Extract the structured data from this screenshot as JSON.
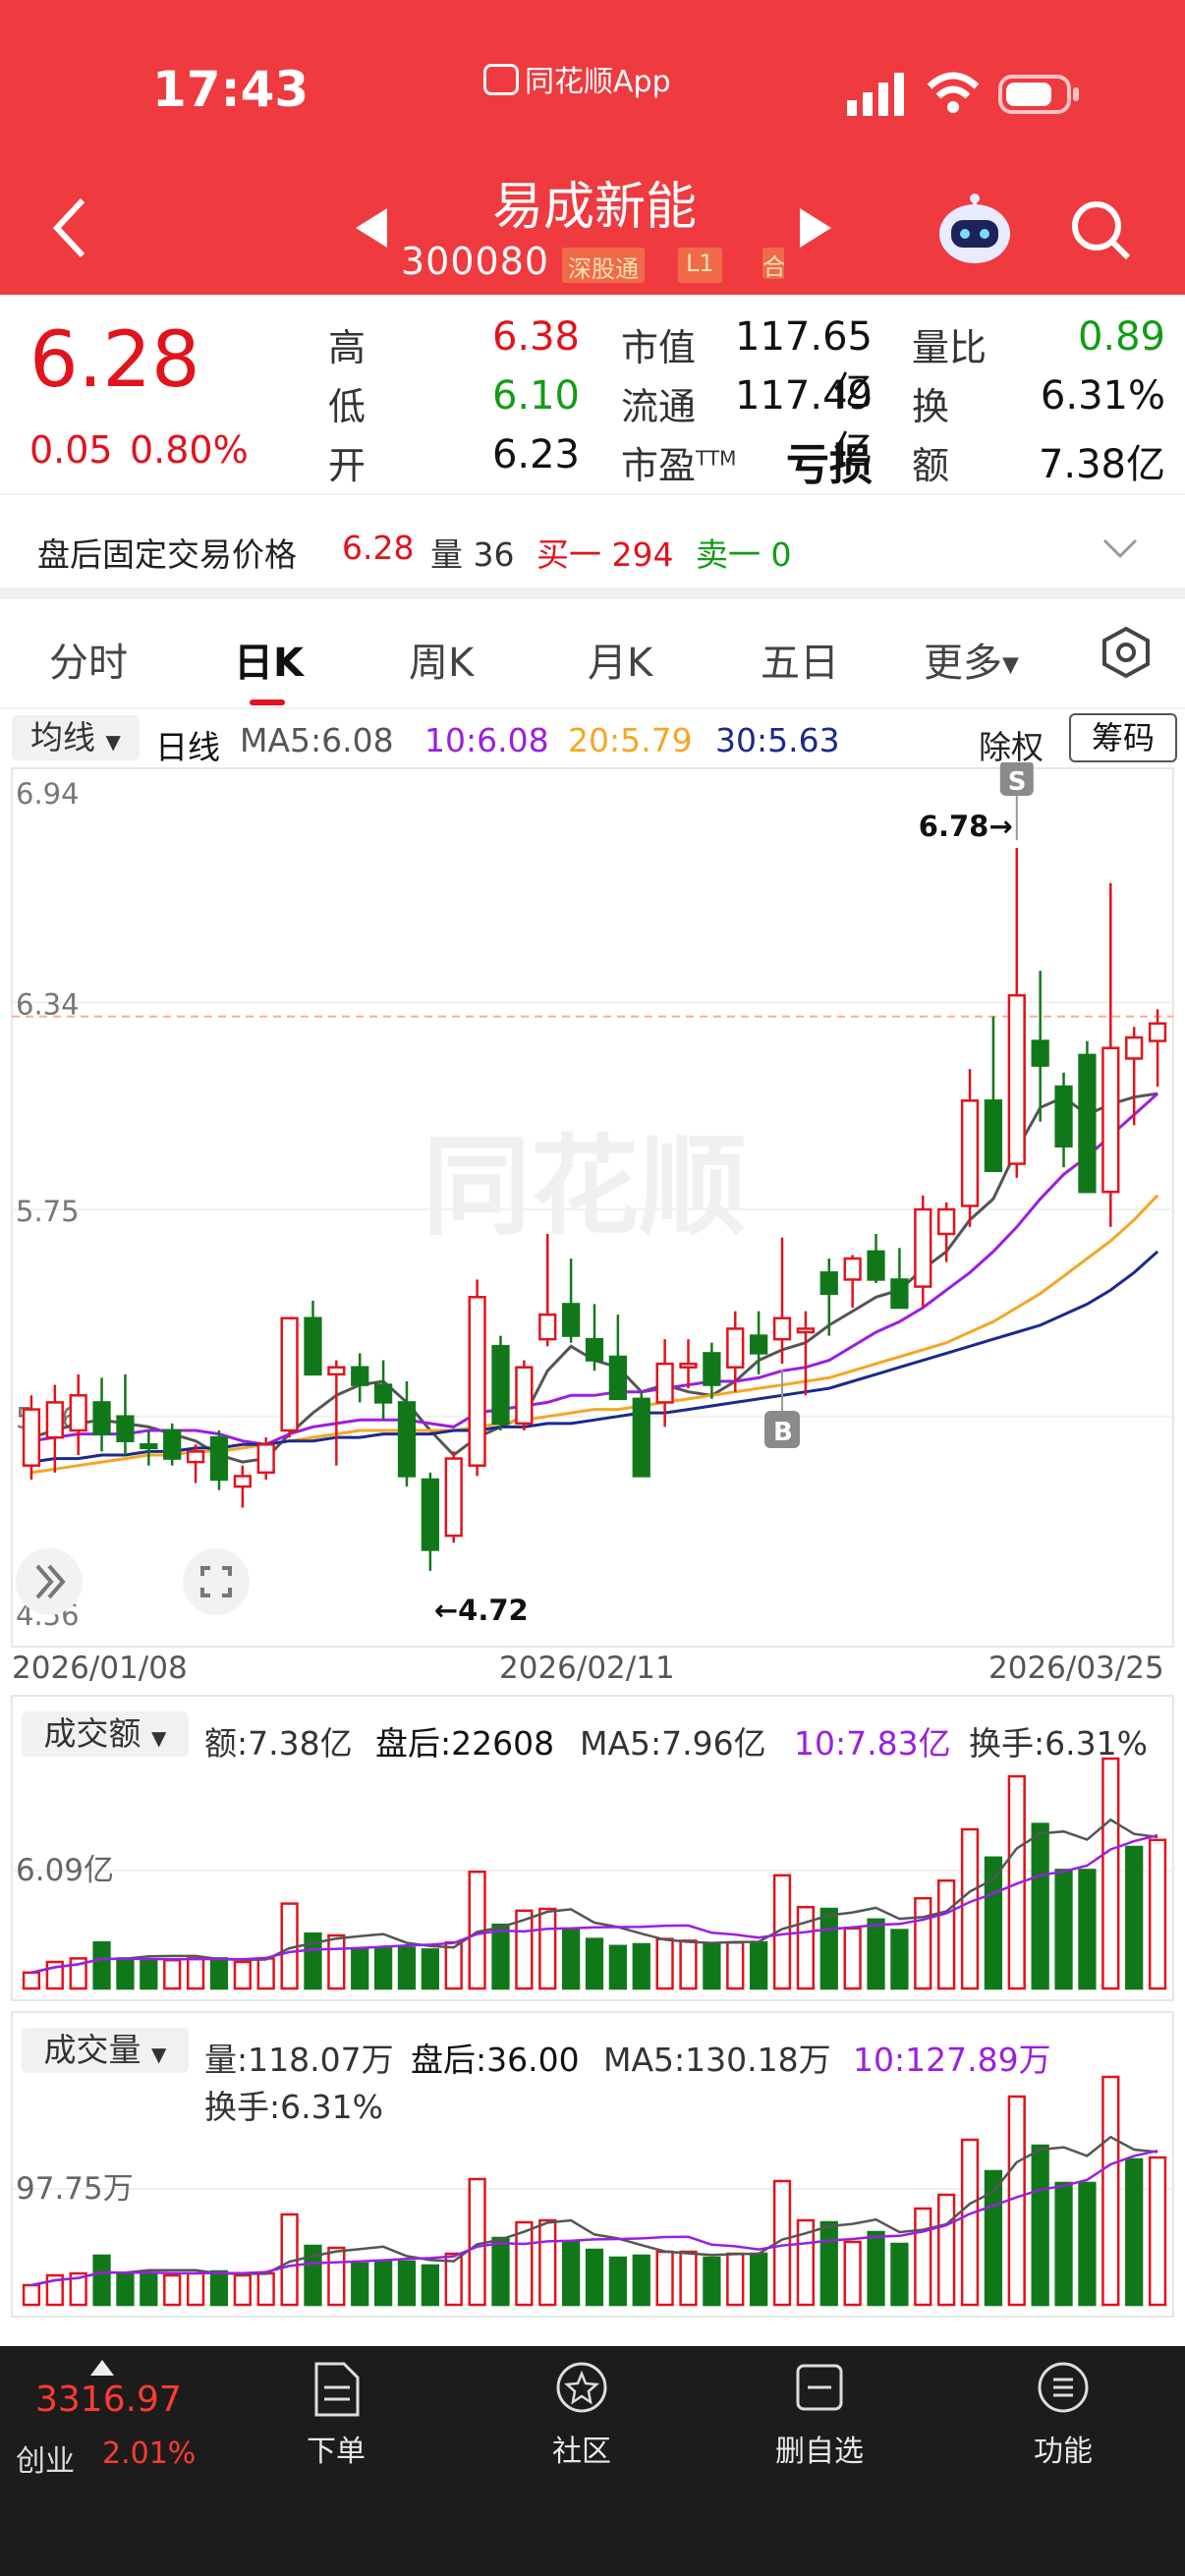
{
  "status": {
    "time": "17:43",
    "app": "同花顺App"
  },
  "header": {
    "stock_name": "易成新能",
    "code": "300080",
    "tag1": "深股通",
    "tag2": "L1",
    "tag3": "合"
  },
  "quote": {
    "price": "6.28",
    "change": "0.05",
    "change_pct": "0.80%",
    "rows": [
      [
        {
          "l": "高",
          "v": "6.38"
        },
        {
          "l": "市值",
          "v": "117.65亿"
        },
        {
          "l": "量比",
          "v": "0.89"
        }
      ],
      [
        {
          "l": "低",
          "v": "6.10"
        },
        {
          "l": "流通",
          "v": "117.49亿"
        },
        {
          "l": "换",
          "v": "6.31%"
        }
      ],
      [
        {
          "l": "开",
          "v": "6.23"
        },
        {
          "l": "市盈",
          "v": "亏损"
        },
        {
          "l": "额",
          "v": "7.38亿"
        }
      ]
    ],
    "ttm": "TTM"
  },
  "after_hours": {
    "label": "盘后固定交易价格",
    "price": "6.28",
    "vol_label": "量 36",
    "buy": "买一 294",
    "sell": "卖一 0"
  },
  "tabs": [
    "分时",
    "日K",
    "周K",
    "月K",
    "五日",
    "更多"
  ],
  "active_tab": "日K",
  "ma_legend": {
    "select": "均线",
    "period": "日线",
    "ma5": "MA5:6.08",
    "ma10": "10:6.08",
    "ma20": "20:5.79",
    "ma30": "30:5.63",
    "fq": "除权",
    "chips": "筹码"
  },
  "colors": {
    "up": "#e1131c",
    "down": "#11781a",
    "ma5": "#555555",
    "ma10": "#9b1fe0",
    "ma20": "#f5a623",
    "ma30": "#1a2a8c",
    "brand": "#ef3a3f"
  },
  "kline": {
    "y_labels": [
      "6.94",
      "6.34",
      "5.75",
      "5.16",
      "4.56"
    ],
    "x_labels": [
      "2026/01/08",
      "2026/02/11",
      "2026/03/25"
    ],
    "high_marker": "6.78→",
    "low_marker": "←4.72",
    "marker_s": "S",
    "marker_b": "B",
    "watermark": "同花顺"
  },
  "chart_data": [
    {
      "type": "candlestick",
      "ylim": [
        4.56,
        6.94
      ],
      "x_ticks": [
        "2026/01/08",
        "2026/02/11",
        "2026/03/25"
      ],
      "candles": [
        {
          "o": 5.02,
          "h": 5.22,
          "l": 4.98,
          "c": 5.18
        },
        {
          "o": 5.1,
          "h": 5.25,
          "l": 5.0,
          "c": 5.2
        },
        {
          "o": 5.12,
          "h": 5.28,
          "l": 5.05,
          "c": 5.22
        },
        {
          "o": 5.2,
          "h": 5.27,
          "l": 5.06,
          "c": 5.11
        },
        {
          "o": 5.16,
          "h": 5.28,
          "l": 5.05,
          "c": 5.09
        },
        {
          "o": 5.08,
          "h": 5.12,
          "l": 5.02,
          "c": 5.07
        },
        {
          "o": 5.12,
          "h": 5.14,
          "l": 5.02,
          "c": 5.04
        },
        {
          "o": 5.03,
          "h": 5.08,
          "l": 4.97,
          "c": 5.06
        },
        {
          "o": 5.1,
          "h": 5.12,
          "l": 4.95,
          "c": 4.98
        },
        {
          "o": 4.96,
          "h": 5.02,
          "l": 4.9,
          "c": 4.99
        },
        {
          "o": 5.0,
          "h": 5.1,
          "l": 4.98,
          "c": 5.08
        },
        {
          "o": 5.12,
          "h": 5.44,
          "l": 5.1,
          "c": 5.44
        },
        {
          "o": 5.44,
          "h": 5.49,
          "l": 5.28,
          "c": 5.28
        },
        {
          "o": 5.28,
          "h": 5.32,
          "l": 5.02,
          "c": 5.3
        },
        {
          "o": 5.3,
          "h": 5.34,
          "l": 5.2,
          "c": 5.25
        },
        {
          "o": 5.25,
          "h": 5.32,
          "l": 5.15,
          "c": 5.2
        },
        {
          "o": 5.2,
          "h": 5.26,
          "l": 4.96,
          "c": 4.99
        },
        {
          "o": 4.98,
          "h": 5.0,
          "l": 4.72,
          "c": 4.78
        },
        {
          "o": 4.82,
          "h": 5.06,
          "l": 4.8,
          "c": 5.04
        },
        {
          "o": 5.02,
          "h": 5.55,
          "l": 4.99,
          "c": 5.5
        },
        {
          "o": 5.36,
          "h": 5.39,
          "l": 5.12,
          "c": 5.14
        },
        {
          "o": 5.14,
          "h": 5.32,
          "l": 5.12,
          "c": 5.3
        },
        {
          "o": 5.38,
          "h": 5.68,
          "l": 5.36,
          "c": 5.45
        },
        {
          "o": 5.48,
          "h": 5.61,
          "l": 5.37,
          "c": 5.39
        },
        {
          "o": 5.38,
          "h": 5.48,
          "l": 5.29,
          "c": 5.32
        },
        {
          "o": 5.33,
          "h": 5.45,
          "l": 5.25,
          "c": 5.21
        },
        {
          "o": 5.21,
          "h": 5.23,
          "l": 4.99,
          "c": 4.99
        },
        {
          "o": 5.2,
          "h": 5.38,
          "l": 5.13,
          "c": 5.31
        },
        {
          "o": 5.3,
          "h": 5.38,
          "l": 5.24,
          "c": 5.31
        },
        {
          "o": 5.34,
          "h": 5.37,
          "l": 5.21,
          "c": 5.25
        },
        {
          "o": 5.3,
          "h": 5.46,
          "l": 5.23,
          "c": 5.41
        },
        {
          "o": 5.39,
          "h": 5.46,
          "l": 5.28,
          "c": 5.34
        },
        {
          "o": 5.38,
          "h": 5.67,
          "l": 5.31,
          "c": 5.44
        },
        {
          "o": 5.4,
          "h": 5.46,
          "l": 5.22,
          "c": 5.41
        },
        {
          "o": 5.57,
          "h": 5.61,
          "l": 5.39,
          "c": 5.51
        },
        {
          "o": 5.55,
          "h": 5.62,
          "l": 5.47,
          "c": 5.61
        },
        {
          "o": 5.63,
          "h": 5.68,
          "l": 5.54,
          "c": 5.55
        },
        {
          "o": 5.55,
          "h": 5.64,
          "l": 5.49,
          "c": 5.47
        },
        {
          "o": 5.53,
          "h": 5.79,
          "l": 5.47,
          "c": 5.75
        },
        {
          "o": 5.68,
          "h": 5.77,
          "l": 5.6,
          "c": 5.75
        },
        {
          "o": 5.76,
          "h": 6.15,
          "l": 5.7,
          "c": 6.06
        },
        {
          "o": 6.06,
          "h": 6.3,
          "l": 5.87,
          "c": 5.86
        },
        {
          "o": 5.88,
          "h": 6.78,
          "l": 5.84,
          "c": 6.36
        },
        {
          "o": 6.23,
          "h": 6.43,
          "l": 6.0,
          "c": 6.16
        },
        {
          "o": 6.1,
          "h": 6.14,
          "l": 5.87,
          "c": 5.93
        },
        {
          "o": 6.19,
          "h": 6.23,
          "l": 5.91,
          "c": 5.8
        },
        {
          "o": 5.8,
          "h": 6.68,
          "l": 5.7,
          "c": 6.21
        },
        {
          "o": 6.18,
          "h": 6.27,
          "l": 5.99,
          "c": 6.24
        },
        {
          "o": 6.23,
          "h": 6.32,
          "l": 6.1,
          "c": 6.28
        }
      ],
      "series": [
        {
          "name": "MA5",
          "values": [
            5.1,
            5.12,
            5.14,
            5.15,
            5.14,
            5.13,
            5.11,
            5.09,
            5.05,
            5.03,
            5.04,
            5.11,
            5.17,
            5.22,
            5.25,
            5.26,
            5.2,
            5.12,
            5.05,
            5.1,
            5.13,
            5.16,
            5.29,
            5.36,
            5.32,
            5.3,
            5.23,
            5.25,
            5.23,
            5.22,
            5.26,
            5.32,
            5.35,
            5.37,
            5.42,
            5.46,
            5.5,
            5.52,
            5.58,
            5.63,
            5.72,
            5.78,
            5.92,
            6.04,
            6.07,
            6.02,
            6.05,
            6.07,
            6.08
          ]
        },
        {
          "name": "10",
          "values": [
            5.09,
            5.1,
            5.11,
            5.11,
            5.11,
            5.12,
            5.12,
            5.12,
            5.11,
            5.09,
            5.08,
            5.11,
            5.13,
            5.14,
            5.15,
            5.15,
            5.15,
            5.14,
            5.13,
            5.17,
            5.18,
            5.19,
            5.2,
            5.22,
            5.22,
            5.23,
            5.23,
            5.24,
            5.25,
            5.26,
            5.26,
            5.27,
            5.29,
            5.3,
            5.32,
            5.36,
            5.4,
            5.43,
            5.47,
            5.52,
            5.57,
            5.63,
            5.7,
            5.78,
            5.85,
            5.9,
            5.96,
            6.02,
            6.08
          ]
        },
        {
          "name": "20",
          "values": [
            5.0,
            5.01,
            5.02,
            5.03,
            5.04,
            5.05,
            5.05,
            5.06,
            5.06,
            5.07,
            5.08,
            5.09,
            5.1,
            5.11,
            5.12,
            5.12,
            5.12,
            5.12,
            5.12,
            5.13,
            5.14,
            5.15,
            5.16,
            5.17,
            5.18,
            5.18,
            5.19,
            5.2,
            5.21,
            5.22,
            5.23,
            5.24,
            5.25,
            5.26,
            5.27,
            5.29,
            5.31,
            5.33,
            5.35,
            5.37,
            5.4,
            5.43,
            5.47,
            5.51,
            5.56,
            5.61,
            5.66,
            5.72,
            5.79
          ]
        },
        {
          "name": "30",
          "values": [
            5.03,
            5.04,
            5.04,
            5.05,
            5.05,
            5.06,
            5.06,
            5.07,
            5.07,
            5.08,
            5.08,
            5.09,
            5.09,
            5.1,
            5.1,
            5.11,
            5.11,
            5.11,
            5.12,
            5.12,
            5.13,
            5.13,
            5.14,
            5.14,
            5.15,
            5.16,
            5.17,
            5.17,
            5.18,
            5.19,
            5.2,
            5.21,
            5.22,
            5.23,
            5.24,
            5.26,
            5.28,
            5.3,
            5.32,
            5.34,
            5.36,
            5.38,
            5.4,
            5.42,
            5.45,
            5.48,
            5.52,
            5.57,
            5.63
          ]
        }
      ]
    },
    {
      "type": "bar",
      "title": "成交额",
      "values": [
        0.9,
        1.5,
        1.7,
        2.6,
        1.7,
        1.6,
        1.6,
        1.7,
        1.7,
        1.5,
        1.7,
        4.8,
        3.1,
        3.0,
        2.2,
        2.3,
        2.3,
        2.2,
        2.6,
        6.6,
        3.6,
        4.4,
        4.5,
        3.3,
        2.8,
        2.4,
        2.5,
        2.8,
        2.7,
        2.5,
        2.6,
        2.6,
        6.4,
        4.6,
        4.5,
        3.4,
        3.9,
        3.3,
        5.1,
        6.1,
        9.0,
        7.4,
        12.0,
        9.3,
        6.7,
        6.7,
        13.0,
        8.0,
        8.4
      ],
      "up": [
        1,
        1,
        1,
        0,
        0,
        0,
        1,
        1,
        0,
        1,
        1,
        1,
        0,
        1,
        0,
        0,
        0,
        0,
        1,
        1,
        0,
        1,
        1,
        0,
        0,
        0,
        0,
        1,
        1,
        0,
        1,
        0,
        1,
        1,
        0,
        1,
        0,
        0,
        1,
        1,
        1,
        0,
        1,
        0,
        0,
        0,
        1,
        0,
        1
      ],
      "ref_label": "6.09亿"
    },
    {
      "type": "bar",
      "title": "成交量",
      "values": [
        1.0,
        1.5,
        1.6,
        2.5,
        1.6,
        1.6,
        1.5,
        1.6,
        1.7,
        1.5,
        1.6,
        4.6,
        3.0,
        2.9,
        2.1,
        2.2,
        2.2,
        2.0,
        2.6,
        6.4,
        3.4,
        4.2,
        4.3,
        3.2,
        2.8,
        2.4,
        2.5,
        2.7,
        2.7,
        2.4,
        2.6,
        2.6,
        6.3,
        4.3,
        4.2,
        3.2,
        3.7,
        3.1,
        4.9,
        5.6,
        8.4,
        6.8,
        10.6,
        8.1,
        6.2,
        6.2,
        11.6,
        7.4,
        7.5
      ],
      "up": [
        1,
        1,
        1,
        0,
        0,
        0,
        1,
        1,
        0,
        1,
        1,
        1,
        0,
        1,
        0,
        0,
        0,
        0,
        1,
        1,
        0,
        1,
        1,
        0,
        0,
        0,
        0,
        1,
        1,
        0,
        1,
        0,
        1,
        1,
        0,
        1,
        0,
        0,
        1,
        1,
        1,
        0,
        1,
        0,
        0,
        0,
        1,
        0,
        1
      ],
      "ref_label": "97.75万"
    }
  ],
  "amount_legend": {
    "select": "成交额",
    "amt": "额:7.38亿",
    "after": "盘后:22608",
    "ma5": "MA5:7.96亿",
    "ma10": "10:7.83亿",
    "turnover": "换手:6.31%"
  },
  "volume_legend": {
    "select": "成交量",
    "vol": "量:118.07万",
    "after": "盘后:36.00",
    "ma5": "MA5:130.18万",
    "ma10": "10:127.89万",
    "turnover": "换手:6.31%"
  },
  "bottom_nav": {
    "index_value": "3316.97",
    "index_name": "创业",
    "index_pct": "2.01%",
    "items": [
      "下单",
      "社区",
      "删自选",
      "功能"
    ]
  }
}
